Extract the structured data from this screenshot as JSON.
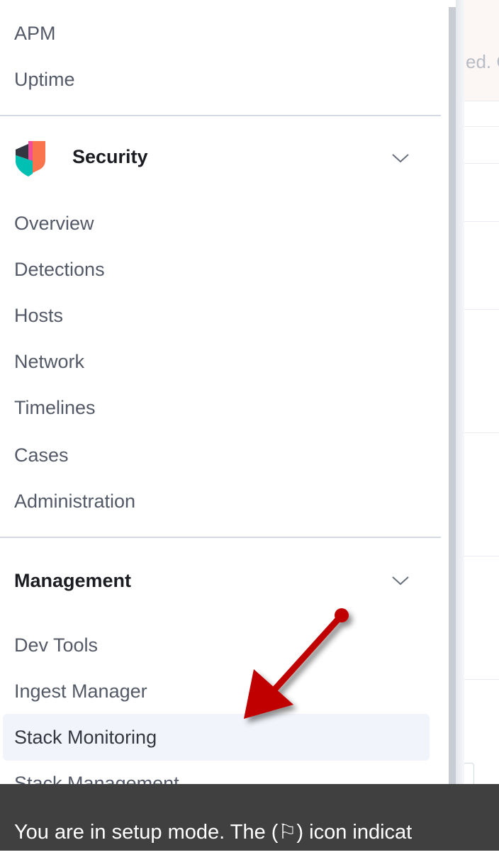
{
  "nav": {
    "observability_links": [
      "APM",
      "Uptime"
    ],
    "security": {
      "title": "Security",
      "icon": "security-shield-icon",
      "icon_colors": [
        "#f04e98",
        "#fa744e",
        "#00bfb3",
        "#343741"
      ],
      "links": [
        "Overview",
        "Detections",
        "Hosts",
        "Network",
        "Timelines",
        "Cases",
        "Administration"
      ]
    },
    "management": {
      "title": "Management",
      "links": [
        "Dev Tools",
        "Ingest Manager",
        "Stack Monitoring",
        "Stack Management"
      ],
      "selected": "Stack Monitoring"
    }
  },
  "background": {
    "peek_text": "ed. C"
  },
  "toast": {
    "text": "You are in setup mode. The (⚐) icon indicat"
  },
  "annotation": {
    "arrow_color": "#c00000",
    "arrow_target": "Stack Monitoring"
  }
}
